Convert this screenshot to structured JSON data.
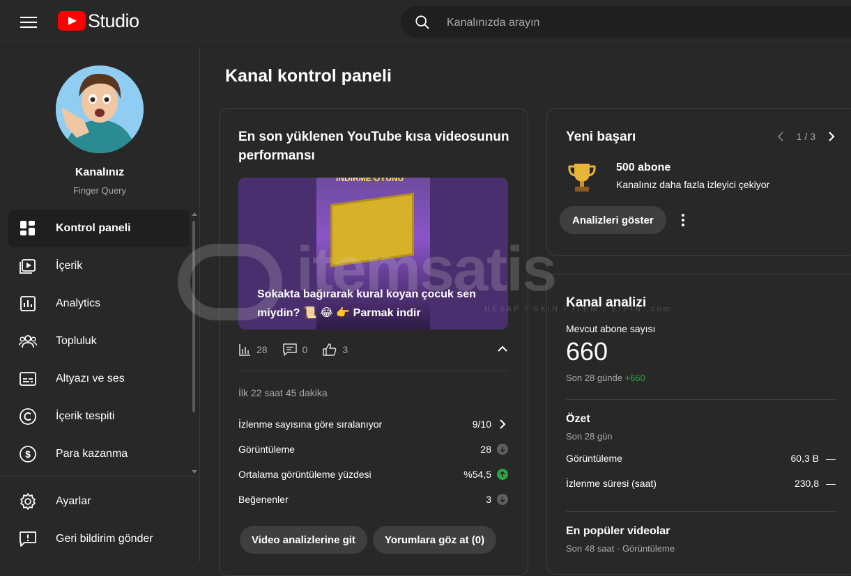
{
  "header": {
    "logo_text": "Studio",
    "search_placeholder": "Kanalınızda arayın"
  },
  "sidebar": {
    "channel_name": "Kanalınız",
    "channel_subtitle": "Finger Query",
    "items": [
      {
        "label": "Kontrol paneli",
        "icon": "dashboard-icon",
        "active": true
      },
      {
        "label": "İçerik",
        "icon": "content-icon"
      },
      {
        "label": "Analytics",
        "icon": "analytics-icon"
      },
      {
        "label": "Topluluk",
        "icon": "community-icon"
      },
      {
        "label": "Altyazı ve ses",
        "icon": "subtitles-icon"
      },
      {
        "label": "İçerik tespiti",
        "icon": "copyright-icon"
      },
      {
        "label": "Para kazanma",
        "icon": "monetization-icon"
      }
    ],
    "bottom_items": [
      {
        "label": "Ayarlar",
        "icon": "gear-icon"
      },
      {
        "label": "Geri bildirim gönder",
        "icon": "feedback-icon"
      }
    ]
  },
  "main": {
    "page_title": "Kanal kontrol paneli",
    "latest_short": {
      "title": "En son yüklenen YouTube kısa videosunun performansı",
      "thumbnail_banner": "İNDİRME OYUNU",
      "video_title": "Sokakta bağırarak kural koyan çocuk sen miydin? 📜 😂 👉 Parmak indir",
      "views": "28",
      "comments": "0",
      "likes": "3",
      "since": "İlk 22 saat 45 dakika",
      "metrics": [
        {
          "label": "İzlenme sayısına göre sıralanıyor",
          "value": "9/10",
          "indicator": "chevron-right"
        },
        {
          "label": "Görüntüleme",
          "value": "28",
          "indicator": "down"
        },
        {
          "label": "Ortalama görüntüleme yüzdesi",
          "value": "%54,5",
          "indicator": "up"
        },
        {
          "label": "Beğenenler",
          "value": "3",
          "indicator": "down"
        }
      ],
      "btn_analytics": "Video analizlerine git",
      "btn_comments": "Yorumlara göz at (0)"
    },
    "achievement": {
      "title": "Yeni başarı",
      "pager": "1 / 3",
      "milestone": "500 abone",
      "description": "Kanalınız daha fazla izleyici çekiyor",
      "button": "Analizleri göster"
    },
    "channel_analytics": {
      "title": "Kanal analizi",
      "subscribers_label": "Mevcut abone sayısı",
      "subscribers": "660",
      "change_prefix": "Son 28 günde",
      "change_value": "+660",
      "summary_title": "Özet",
      "summary_period": "Son 28 gün",
      "rows": [
        {
          "label": "Görüntüleme",
          "value": "60,3 B",
          "trend": "—"
        },
        {
          "label": "İzlenme süresi (saat)",
          "value": "230,8",
          "trend": "—"
        }
      ],
      "top_videos_title": "En popüler videolar",
      "top_videos_sub": "Son 48 saat · Görüntüleme"
    }
  },
  "watermark": {
    "text": "itemsatis",
    "subtext": "HESAP / SKIN / ITEM / E-PIN .com"
  },
  "colors": {
    "background": "#282828",
    "accent_red": "#ff0000",
    "positive_green": "#2ba640",
    "muted_text": "#aaaaaa"
  }
}
